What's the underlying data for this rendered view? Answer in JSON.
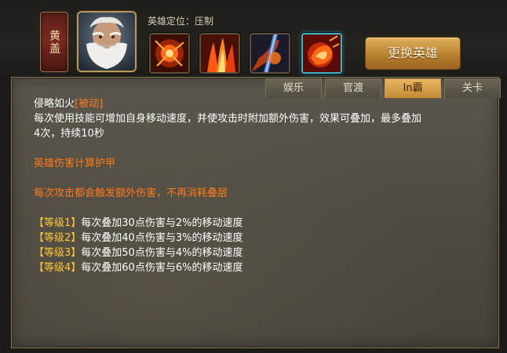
{
  "hero": {
    "name": "黄盖",
    "role_label": "英雄定位：",
    "role_value": "压制",
    "portrait_icon": "old-warrior-portrait"
  },
  "skills": [
    {
      "icon": "fire-burst-icon"
    },
    {
      "icon": "fire-pillars-icon"
    },
    {
      "icon": "flaming-strike-icon"
    },
    {
      "icon": "fire-fist-icon",
      "selected": true
    }
  ],
  "change_button": "更换英雄",
  "tabs": [
    {
      "label": "娱乐",
      "active": false
    },
    {
      "label": "官渡",
      "active": false
    },
    {
      "label": "In霸",
      "active": true
    },
    {
      "label": "关卡",
      "active": false
    }
  ],
  "skill_info": {
    "name": "侵略如火",
    "tag": "[被动]",
    "desc_line1": "每次使用技能可增加自身移动速度，并使攻击时附加额外伤害，效果可叠加，最多叠加",
    "desc_line2": "4次，持续10秒",
    "note1": "英雄伤害计算护甲",
    "note2": "每次攻击都会触发额外伤害，不再消耗叠层",
    "levels": [
      {
        "tag": "【等级1】",
        "text": "每次叠加30点伤害与2%的移动速度"
      },
      {
        "tag": "【等级2】",
        "text": "每次叠加40点伤害与3%的移动速度"
      },
      {
        "tag": "【等级3】",
        "text": "每次叠加50点伤害与4%的移动速度"
      },
      {
        "tag": "【等级4】",
        "text": "每次叠加60点伤害与6%的移动速度"
      }
    ]
  },
  "colors": {
    "accent_gold": "#c58a33",
    "highlight_orange": "#ff7a1c",
    "level_yellow": "#ffc83a",
    "selected_cyan": "#3ab7c9"
  }
}
